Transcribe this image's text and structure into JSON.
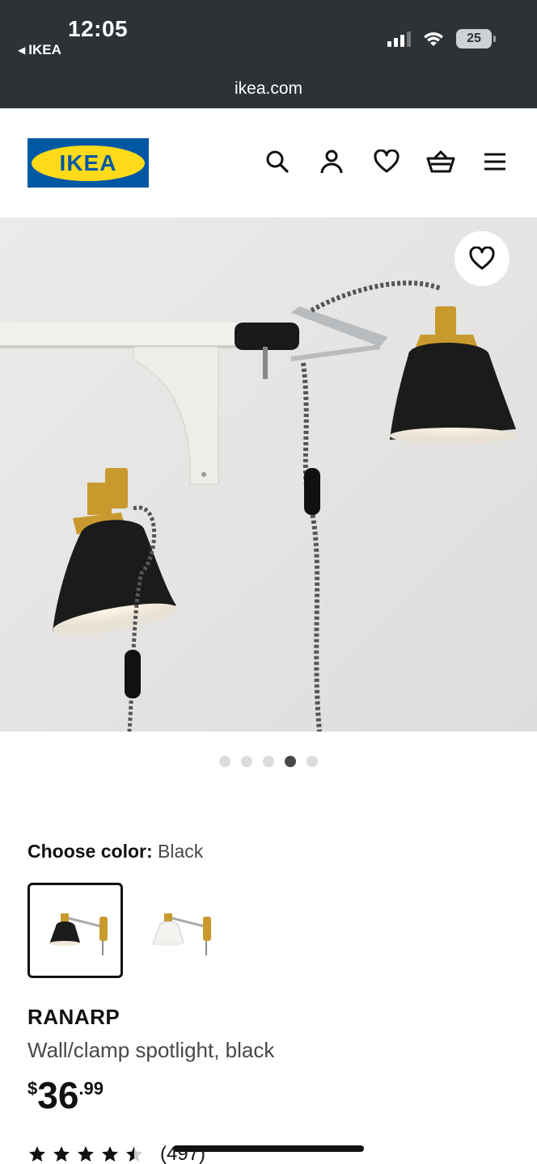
{
  "status_bar": {
    "time": "12:05",
    "back_app": "IKEA",
    "battery": "25",
    "url": "ikea.com"
  },
  "header": {
    "logo_text": "IKEA",
    "icons": [
      "search-icon",
      "account-icon",
      "favorites-icon",
      "cart-icon",
      "menu-icon"
    ]
  },
  "gallery": {
    "image_count": 5,
    "active_index": 3
  },
  "product": {
    "color_label": "Choose color:",
    "color_value": "Black",
    "swatches": [
      "Black",
      "White"
    ],
    "name": "RANARP",
    "description": "Wall/clamp spotlight, black",
    "price_currency": "$",
    "price_integer": "36",
    "price_decimal": ".99",
    "rating_stars": 4.5,
    "review_count": "(497)"
  },
  "colors": {
    "status_bg": "#2d3236",
    "ikea_blue": "#0058a3",
    "ikea_yellow": "#ffda1a"
  }
}
